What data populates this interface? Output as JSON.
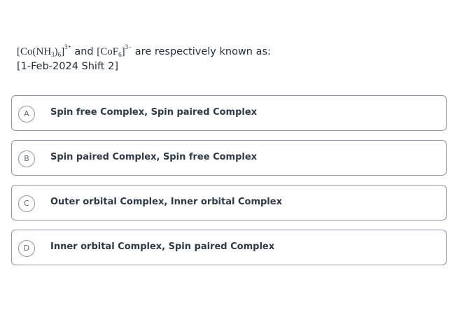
{
  "question": {
    "formula1_prefix": "[Co(NH",
    "formula1_sub1": "3",
    "formula1_mid": ")",
    "formula1_sub2": "6",
    "formula1_close": "]",
    "formula1_sup": "3+",
    "connector": " and ",
    "formula2_prefix": "[CoF",
    "formula2_sub": "6",
    "formula2_close": "]",
    "formula2_sup": "3−",
    "tail": " are respectively known as:",
    "source": "[1-Feb-2024 Shift 2]"
  },
  "options": [
    {
      "letter": "A",
      "text": "Spin free Complex, Spin paired Complex"
    },
    {
      "letter": "B",
      "text": "Spin paired Complex, Spin free Complex"
    },
    {
      "letter": "C",
      "text": "Outer orbital Complex, Inner orbital Complex"
    },
    {
      "letter": "D",
      "text": "Inner orbital Complex, Spin paired Complex"
    }
  ],
  "colors": {
    "border": "#8e97a3",
    "text": "#2d3a48",
    "background": "#ffffff"
  }
}
